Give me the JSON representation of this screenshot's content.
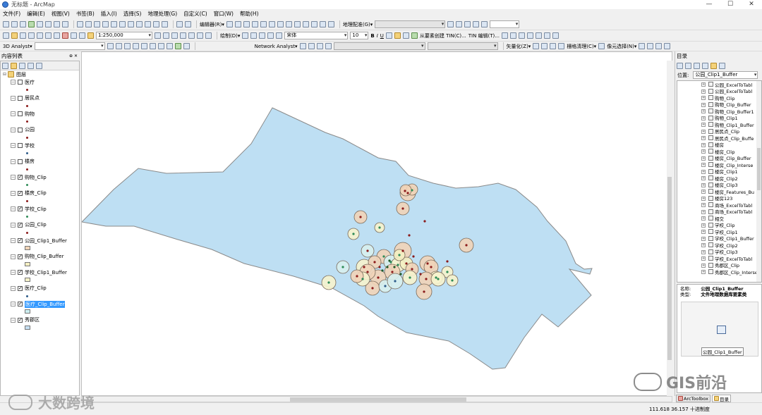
{
  "window": {
    "title": "无标题 - ArcMap",
    "controls": [
      "—",
      "☐",
      "✕"
    ]
  },
  "menu": [
    "文件(F)",
    "编辑(E)",
    "视图(V)",
    "书签(B)",
    "插入(I)",
    "选择(S)",
    "地理处理(G)",
    "自定义(C)",
    "窗口(W)",
    "帮助(H)"
  ],
  "toolbar1": {
    "editor": "编辑器(R)▾",
    "georef": "地理配准(G)▾"
  },
  "toolbar2": {
    "scale": "1:250,000",
    "draw": "绘制(D)▾",
    "font": "宋体",
    "fontsize": "10",
    "bold": "B",
    "italic": "I",
    "underline": "U",
    "tin": "从要素创建 TIN(C)...",
    "tin_editor": "TIN 编辑(T)..."
  },
  "toolbar3": {
    "analyst3d": "3D Analyst▾",
    "network": "Network Analyst▾",
    "vectorize": "矢量化(Z)▾",
    "raster_clean": "栅格清理(C)▾",
    "cell_select": "像元选择(N)▾"
  },
  "toc": {
    "title": "内容列表",
    "pin": "⊕ ✕",
    "root": "图层",
    "layers": [
      {
        "name": "医疗",
        "checked": false,
        "sym": "dot",
        "color": "#8b1a1a"
      },
      {
        "name": "居民点",
        "checked": false,
        "sym": "dot",
        "color": "#8b1a1a"
      },
      {
        "name": "购物",
        "checked": false,
        "sym": "dot",
        "color": "#8b1a1a"
      },
      {
        "name": "公园",
        "checked": false,
        "sym": "dot",
        "color": "#8b1a1a"
      },
      {
        "name": "学校",
        "checked": false,
        "sym": "dot",
        "color": "#2e5c8a"
      },
      {
        "name": "楼房",
        "checked": false,
        "sym": "dot",
        "color": "#8b1a1a"
      },
      {
        "name": "购物_Clip",
        "checked": true,
        "sym": "dot",
        "color": "#2e8b57"
      },
      {
        "name": "楼房_Clip",
        "checked": true,
        "sym": "dot",
        "color": "#8b1a1a"
      },
      {
        "name": "学校_Clip",
        "checked": true,
        "sym": "dot",
        "color": "#2e8b57"
      },
      {
        "name": "公园_Clip",
        "checked": true,
        "sym": "dot",
        "color": "#8b1a1a"
      },
      {
        "name": "公园_Clip1_Buffer",
        "checked": true,
        "sym": "box",
        "color": "#f1d4b8"
      },
      {
        "name": "购物_Clip_Buffer",
        "checked": true,
        "sym": "box",
        "color": "#f4efc2"
      },
      {
        "name": "学校_Clip1_Buffer",
        "checked": true,
        "sym": "box",
        "color": "#f4f0c8"
      },
      {
        "name": "医疗_Clip",
        "checked": true,
        "sym": "dot",
        "color": "#2e5c8a"
      },
      {
        "name": "医疗_Clip_Buffer",
        "checked": true,
        "sym": "box",
        "color": "#cdeef0",
        "selected": true
      },
      {
        "name": "秀郡区",
        "checked": true,
        "sym": "box",
        "color": "#c6dff2"
      }
    ]
  },
  "catalog": {
    "title": "目录",
    "location_label": "位置:",
    "location_value": "公园_Clip1_Buffer",
    "items": [
      "公园_ExcelToTabl",
      "公园_ExcelToTabl",
      "购物_Clip",
      "购物_Clip_Buffer",
      "购物_Clip_Buffer1",
      "购物_Clip1",
      "购物_Clip1_Buffer",
      "居民点_Clip",
      "居民点_Clip_Buffe",
      "楼房",
      "楼房_Clip",
      "楼房_Clip_Buffer",
      "楼房_Clip_Interse",
      "楼房_Clip1",
      "楼房_Clip2",
      "楼房_Clip3",
      "楼房_Features_Bu",
      "楼房123",
      "商场_ExcelToTabl",
      "商场_ExcelToTabl",
      "相交",
      "学校_Clip",
      "学校_Clip1",
      "学校_Clip1_Buffer",
      "学校_Clip2",
      "学校_Clip3",
      "学校_ExcelToTabl",
      "秀郡区_Clip",
      "秀郡区_Clip_Interse"
    ],
    "details_name_label": "名称:",
    "details_name": "公园_Clip1_Buffer",
    "details_type_label": "类型:",
    "details_type": "文件地理数据库要素类",
    "thumb_caption": "公园_Clip1_Buffer",
    "tabs": [
      "ArcToolbox",
      "目录"
    ]
  },
  "status": {
    "coords": "111.618  36.157 十进制度"
  },
  "watermarks": {
    "left": "大数跨境",
    "right": "GIS前沿"
  },
  "map": {
    "region_color": "#bedff3",
    "region_stroke": "#8a8a8a",
    "park_buffer": "#f1d4b8",
    "shop_buffer": "#f4efc2",
    "school_buffer": "#f6f3cd",
    "med_buffer": "#d7f0ee"
  }
}
